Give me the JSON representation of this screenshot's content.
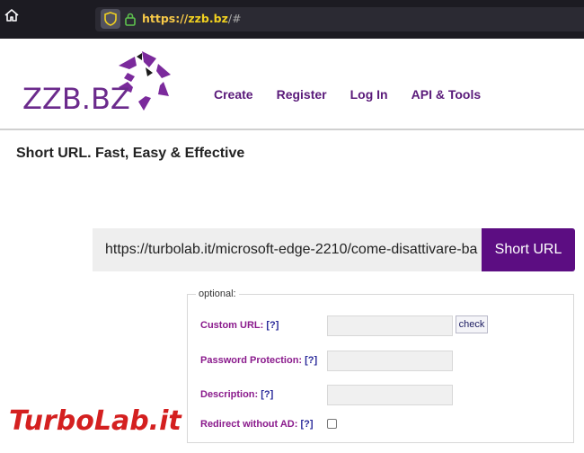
{
  "browser": {
    "url_scheme": "https://",
    "url_host": "zzb.bz",
    "url_path": "/#",
    "icons": [
      "home-icon",
      "shield-icon",
      "lock-icon"
    ]
  },
  "site": {
    "logo_text": "ZZB.BZ",
    "nav": [
      "Create",
      "Register",
      "Log In",
      "API & Tools"
    ],
    "heading": "Short URL. Fast, Easy & Effective"
  },
  "form": {
    "url_value": "https://turbolab.it/microsoft-edge-2210/come-disattivare-ba",
    "submit_label": "Short URL",
    "optional_legend": "optional:",
    "custom_url_label": "Custom URL:",
    "password_label": "Password Protection:",
    "description_label": "Description:",
    "redirect_label": "Redirect without AD:",
    "help_label": "[?]",
    "check_label": "check"
  },
  "watermark": {
    "text": "TurboLab.it"
  },
  "colors": {
    "brand_purple": "#5c0d82",
    "nav_purple": "#5a1a7a",
    "label_magenta": "#8a1a8c",
    "chrome_bg": "#1c1b22"
  }
}
